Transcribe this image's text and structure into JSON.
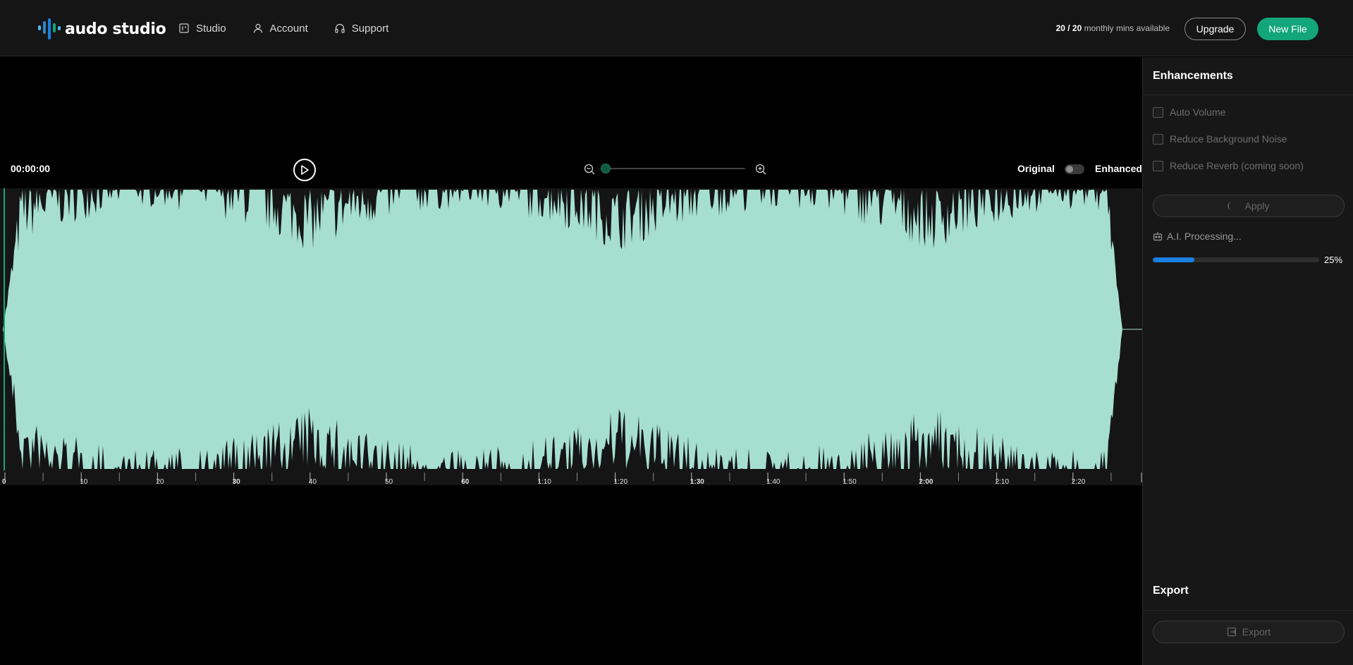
{
  "app": {
    "logo_text": "audo studio",
    "brand_color": "#13a67a",
    "waveform_color": "#a6dfcf"
  },
  "nav": {
    "items": [
      {
        "label": "Studio",
        "icon": "studio-icon"
      },
      {
        "label": "Account",
        "icon": "user-icon"
      },
      {
        "label": "Support",
        "icon": "headphones-icon"
      }
    ]
  },
  "header": {
    "mins_used": "20 / 20",
    "mins_suffix": "monthly mins available",
    "upgrade_label": "Upgrade",
    "new_file_label": "New File"
  },
  "player": {
    "timecode": "00:00:00",
    "zoom_level": 0,
    "original_label": "Original",
    "enhanced_label": "Enhanced",
    "enhanced_on": false
  },
  "timeline": {
    "labels": [
      "0",
      "10",
      "20",
      "30",
      "40",
      "50",
      "60",
      "1:10",
      "1:20",
      "1:30",
      "1:40",
      "1:50",
      "2:00",
      "2:10",
      "2:20"
    ]
  },
  "enhancements": {
    "title": "Enhancements",
    "options": [
      {
        "label": "Auto Volume",
        "checked": false
      },
      {
        "label": "Reduce Background Noise",
        "checked": false
      },
      {
        "label": "Reduce Reverb (coming soon)",
        "checked": false
      }
    ],
    "apply_label": "Apply",
    "processing_label": "A.I. Processing...",
    "progress": 0.25,
    "progress_text": "25%"
  },
  "export": {
    "title": "Export",
    "button_label": "Export"
  }
}
